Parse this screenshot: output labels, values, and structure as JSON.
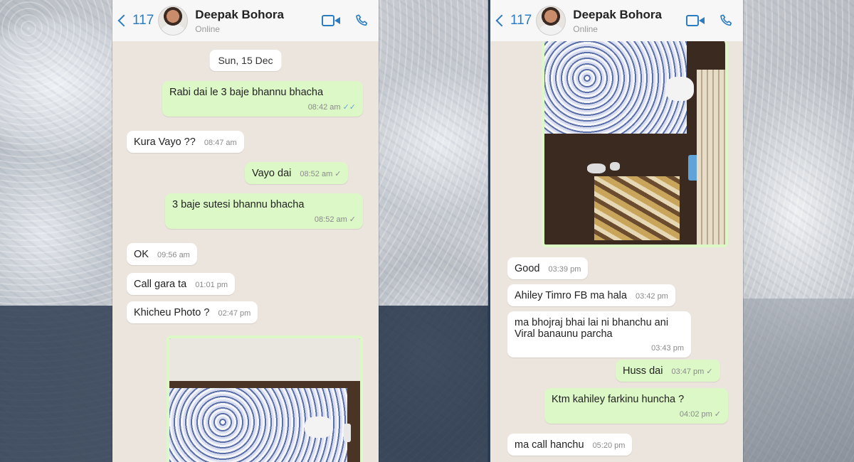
{
  "header": {
    "back_count": "117",
    "contact_name": "Deepak Bohora",
    "status": "Online"
  },
  "left_chat": {
    "date": "Sun, 15 Dec",
    "messages": [
      {
        "dir": "out",
        "text": "Rabi dai le 3 baje bhannu bhacha",
        "time": "08:42 am",
        "ticks": "double"
      },
      {
        "dir": "in",
        "text": "Kura Vayo ??",
        "time": "08:47 am"
      },
      {
        "dir": "out",
        "text": "Vayo dai",
        "time": "08:52 am",
        "ticks": "single"
      },
      {
        "dir": "out",
        "text": "3 baje sutesi bhannu bhacha",
        "time": "08:52 am",
        "ticks": "single"
      },
      {
        "dir": "in",
        "text": "OK",
        "time": "09:56 am"
      },
      {
        "dir": "in",
        "text": "Call gara ta",
        "time": "01:01 pm"
      },
      {
        "dir": "in",
        "text": "Khicheu Photo ?",
        "time": "02:47 pm"
      }
    ]
  },
  "right_chat": {
    "messages": [
      {
        "dir": "in",
        "text": "Good",
        "time": "03:39 pm"
      },
      {
        "dir": "in",
        "text": "Ahiley Timro FB ma hala",
        "time": "03:42 pm"
      },
      {
        "dir": "in",
        "text": "ma bhojraj bhai lai ni bhanchu ani Viral banaunu parcha",
        "time": "03:43 pm"
      },
      {
        "dir": "out",
        "text": "Huss dai",
        "time": "03:47 pm",
        "ticks": "single"
      },
      {
        "dir": "out",
        "text": "Ktm kahiley farkinu huncha ?",
        "time": "04:02 pm",
        "ticks": "single"
      },
      {
        "dir": "in",
        "text": "ma call hanchu",
        "time": "05:20 pm"
      }
    ]
  },
  "icons": {
    "back": "chevron-left-icon",
    "video": "video-call-icon",
    "call": "phone-call-icon",
    "tick_single": "✓",
    "tick_double": "✓✓"
  },
  "colors": {
    "accent": "#2c7cc1",
    "outgoing_bubble": "#dcf8c6",
    "incoming_bubble": "#ffffff",
    "chat_background": "#ece5dd",
    "read_tick": "#6aa3d8"
  }
}
